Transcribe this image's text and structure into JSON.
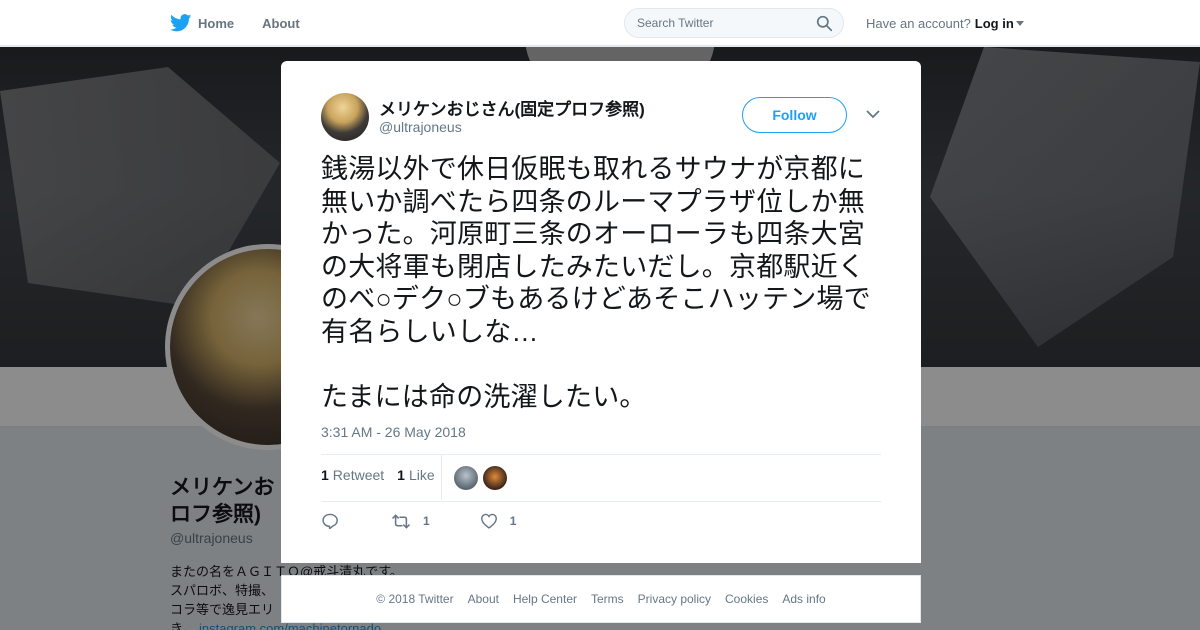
{
  "nav": {
    "home_label": "Home",
    "about_label": "About",
    "search_placeholder": "Search Twitter",
    "account_prompt": "Have an account?",
    "login_label": "Log in"
  },
  "profile_background": {
    "name": "メリケンおじさん(固定プロフ参照)",
    "name_visible": "メリケンお ロフ参照)",
    "name_line1": "メリケンお",
    "name_line2": "ロフ参照)",
    "handle": "@ultrajoneus",
    "bio_line1": "またの名をＡＧＩＴＯ@戒斗清丸です。",
    "bio_line2": "スパロボ、特撮、",
    "bio_line3": "コラ等で逸見エリ",
    "bio_line4_prefix": "き。",
    "bio_link": "instagram.com/machinetornado"
  },
  "tweet": {
    "author_name": "メリケンおじさん(固定プロフ参照)",
    "author_handle": "@ultrajoneus",
    "follow_label": "Follow",
    "text": "銭湯以外で休日仮眠も取れるサウナが京都に無いか調べたら四条のルーマプラザ位しか無かった。河原町三条のオーローラも四条大宮の大将軍も閉店したみたいだし。京都駅近くのべ○デク○ブもあるけどあそこハッテン場で有名らしいしな…\n\nたまには命の洗濯したい。",
    "timestamp": "3:31 AM - 26 May 2018",
    "retweet_count": "1",
    "retweet_label": "Retweet",
    "like_count": "1",
    "like_label": "Like",
    "action_retweet_count": "1",
    "action_like_count": "1"
  },
  "footer": {
    "links": [
      "© 2018 Twitter",
      "About",
      "Help Center",
      "Terms",
      "Privacy policy",
      "Cookies",
      "Ads info"
    ]
  },
  "colors": {
    "brand_blue": "#1da1f2",
    "text_primary": "#14171a",
    "text_secondary": "#657786"
  },
  "icons": [
    "twitter-bird-icon",
    "home-icon",
    "search-icon",
    "close-icon",
    "chevron-down-icon",
    "reply-icon",
    "retweet-icon",
    "heart-icon"
  ]
}
